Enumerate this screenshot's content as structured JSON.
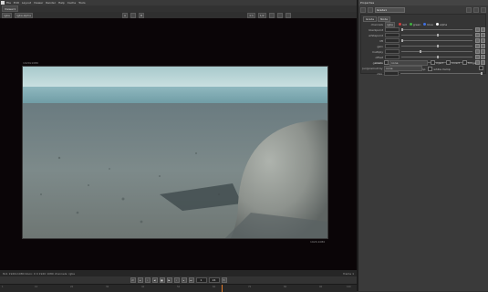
{
  "menubar": {
    "items": [
      "File",
      "Edit",
      "Layout",
      "Viewer",
      "Render",
      "Help",
      "Cache",
      "Tools"
    ]
  },
  "viewer": {
    "tab_label": "Viewer1",
    "toolbar": {
      "channels": "rgba",
      "layer": "rgba.alpha",
      "input_a": "A",
      "input_b": "B",
      "zoom": "1:1",
      "proxy": "1/2"
    },
    "format_label": "1920x1080",
    "bbox_label": "1920,1080",
    "status_text": "8x1 1920x1080 bbox: 0 0 1920 1080 channels: rgba",
    "status_right": "frame 1"
  },
  "playback": {
    "frame": "1",
    "fps": "24"
  },
  "timeline": {
    "ticks": [
      "1",
      "10",
      "20",
      "30",
      "40",
      "50",
      "60",
      "70",
      "80",
      "90",
      "100"
    ]
  },
  "properties": {
    "title": "Properties",
    "node_name": "Grade1",
    "tabs": [
      "Grade",
      "Node"
    ],
    "channels_label": "channels",
    "channels_value": "rgba",
    "checks": [
      "red",
      "green",
      "blue",
      "alpha"
    ],
    "rows": [
      {
        "label": "blackpoint",
        "value": 0.0
      },
      {
        "label": "whitepoint",
        "value": 1.0
      },
      {
        "label": "lift",
        "value": 0.0
      },
      {
        "label": "gain",
        "value": 1.0
      },
      {
        "label": "multiply",
        "value": 1.0
      },
      {
        "label": "offset",
        "value": 0.0
      },
      {
        "label": "gamma",
        "value": 1.0
      }
    ],
    "reverse_label": "reverse",
    "black_clamp_label": "black clamp",
    "white_clamp_label": "white clamp",
    "mask_label": "mask",
    "mask_value": "none",
    "inject_label": "inject",
    "invert_label": "invert",
    "fringe_label": "fringe",
    "unpremult_label": "(un)premult by",
    "unpremult_value": "none",
    "mix_label": "mix",
    "mix_value": 1.0
  },
  "colors": {
    "accent": "#e07a2a",
    "red": "#d04040",
    "green": "#40b040",
    "blue": "#4070e0"
  }
}
